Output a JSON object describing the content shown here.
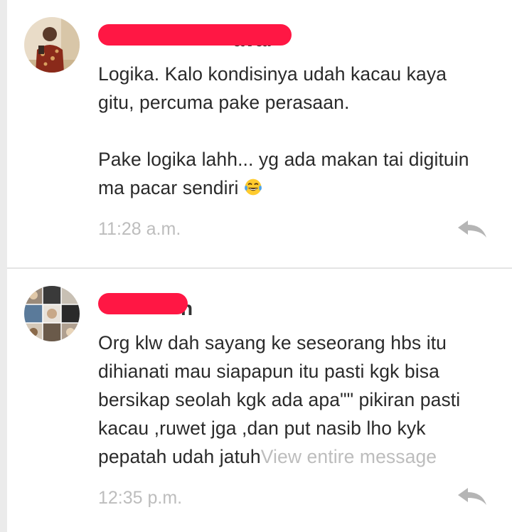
{
  "comments": [
    {
      "author_visible": "avai",
      "body": [
        "Logika. Kalo kondisinya udah kacau kaya",
        "gitu, percuma pake perasaan.",
        "Pake logika lahh... yg ada makan tai digituin",
        "ma pacar sendiri"
      ],
      "emoji": "face-with-tears-of-joy-icon",
      "time": "11:28 a.m."
    },
    {
      "author_visible": "h",
      "body": [
        "Org klw dah sayang ke seseorang hbs itu",
        "dihianati mau siapapun itu pasti kgk bisa",
        "bersikap seolah kgk ada apa\"\" pikiran pasti",
        "kacau ,ruwet jga ,dan put nasib lho kyk",
        "pepatah udah jatuh"
      ],
      "more_link": "View entire message",
      "time": "12:35 p.m."
    }
  ],
  "icons": {
    "reply": "reply-arrow-icon"
  },
  "colors": {
    "redaction": "#ff1744",
    "body_text": "#2a2a2a",
    "muted_text": "#bdbdbd",
    "background": "#ebebeb"
  }
}
